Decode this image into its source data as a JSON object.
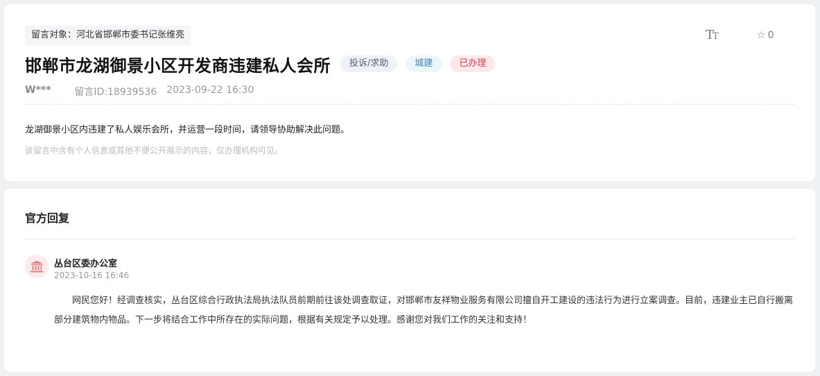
{
  "message": {
    "target_label": "留言对象：",
    "target": "河北省邯郸市委书记张维亮",
    "title": "邯郸市龙湖御景小区开发商违建私人会所",
    "tags": {
      "type": "投诉/求助",
      "category": "城建",
      "status": "已办理"
    },
    "author": "W***",
    "message_id": "留言ID:18939536",
    "datetime": "2023-09-22 16:30",
    "content": "龙湖御景小区内违建了私人娱乐会所，并运营一段时间，请领导协助解决此问题。",
    "privacy_note": "该留言中含有个人信息或其他不便公开展示的内容，仅办理机构可见。",
    "favorite_count": "0",
    "colors": {
      "status": "#d64152",
      "category": "#3b86b0",
      "type": "#556070"
    }
  },
  "toolbar": {
    "font_icon": "text-size-icon",
    "star_icon": "star-icon"
  },
  "reply": {
    "section_title": "官方回复",
    "org_icon": "government-building-icon",
    "org_name": "丛台区委办公室",
    "datetime": "2023-10-16 16:46",
    "body": "网民您好！经调查核实，丛台区综合行政执法局执法队员前期前往该处调查取证，对邯郸市友祥物业服务有限公司擅自开工建设的违法行为进行立案调查。目前，违建业主已自行搬离部分建筑物内物品。下一步将结合工作中所存在的实际问题，根据有关规定予以处理。感谢您对我们工作的关注和支持！"
  }
}
